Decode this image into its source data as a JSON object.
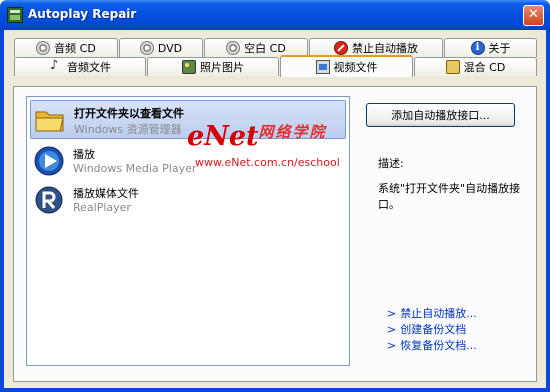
{
  "window": {
    "title": "Autoplay Repair",
    "close_symbol": "✕"
  },
  "tabs_row1": [
    {
      "label": "音频 CD",
      "icon": "cd-icon"
    },
    {
      "label": "DVD",
      "icon": "dvd-icon"
    },
    {
      "label": "空白 CD",
      "icon": "blank-cd-icon"
    },
    {
      "label": "禁止自动播放",
      "icon": "stop-icon"
    },
    {
      "label": "关于",
      "icon": "info-icon"
    }
  ],
  "tabs_row2": [
    {
      "label": "音频文件",
      "icon": "music-note-icon"
    },
    {
      "label": "照片图片",
      "icon": "photo-icon"
    },
    {
      "label": "视频文件",
      "icon": "video-icon",
      "active": true
    },
    {
      "label": "混合 CD",
      "icon": "mixed-cd-icon"
    }
  ],
  "handlers": [
    {
      "title": "打开文件夹以查看文件",
      "subtitle": "Windows 资源管理器",
      "icon": "folder-icon",
      "selected": true
    },
    {
      "title": "播放",
      "subtitle": "Windows Media Player",
      "icon": "media-player-icon",
      "selected": false
    },
    {
      "title": "播放媒体文件",
      "subtitle": "RealPlayer",
      "icon": "realplayer-icon",
      "selected": false
    }
  ],
  "watermark": {
    "logo": "eNet",
    "logo_cn": "网络学院",
    "url": "www.eNet.com.cn/eschool"
  },
  "actions": {
    "add_button": "添加自动播放接口..."
  },
  "description": {
    "label": "描述:",
    "text": "系统\"打开文件夹\"自动播放接口。"
  },
  "links": [
    {
      "arrow": ">",
      "label": "禁止自动播放..."
    },
    {
      "arrow": ">",
      "label": "创建备份文档"
    },
    {
      "arrow": ">",
      "label": "恢复备份文档..."
    }
  ],
  "colors": {
    "titlebar": "#0650dd",
    "selection": "#c6d5f3",
    "watermark": "#d40000",
    "link": "#0034c0",
    "active_tab_accent": "#e69a24"
  }
}
